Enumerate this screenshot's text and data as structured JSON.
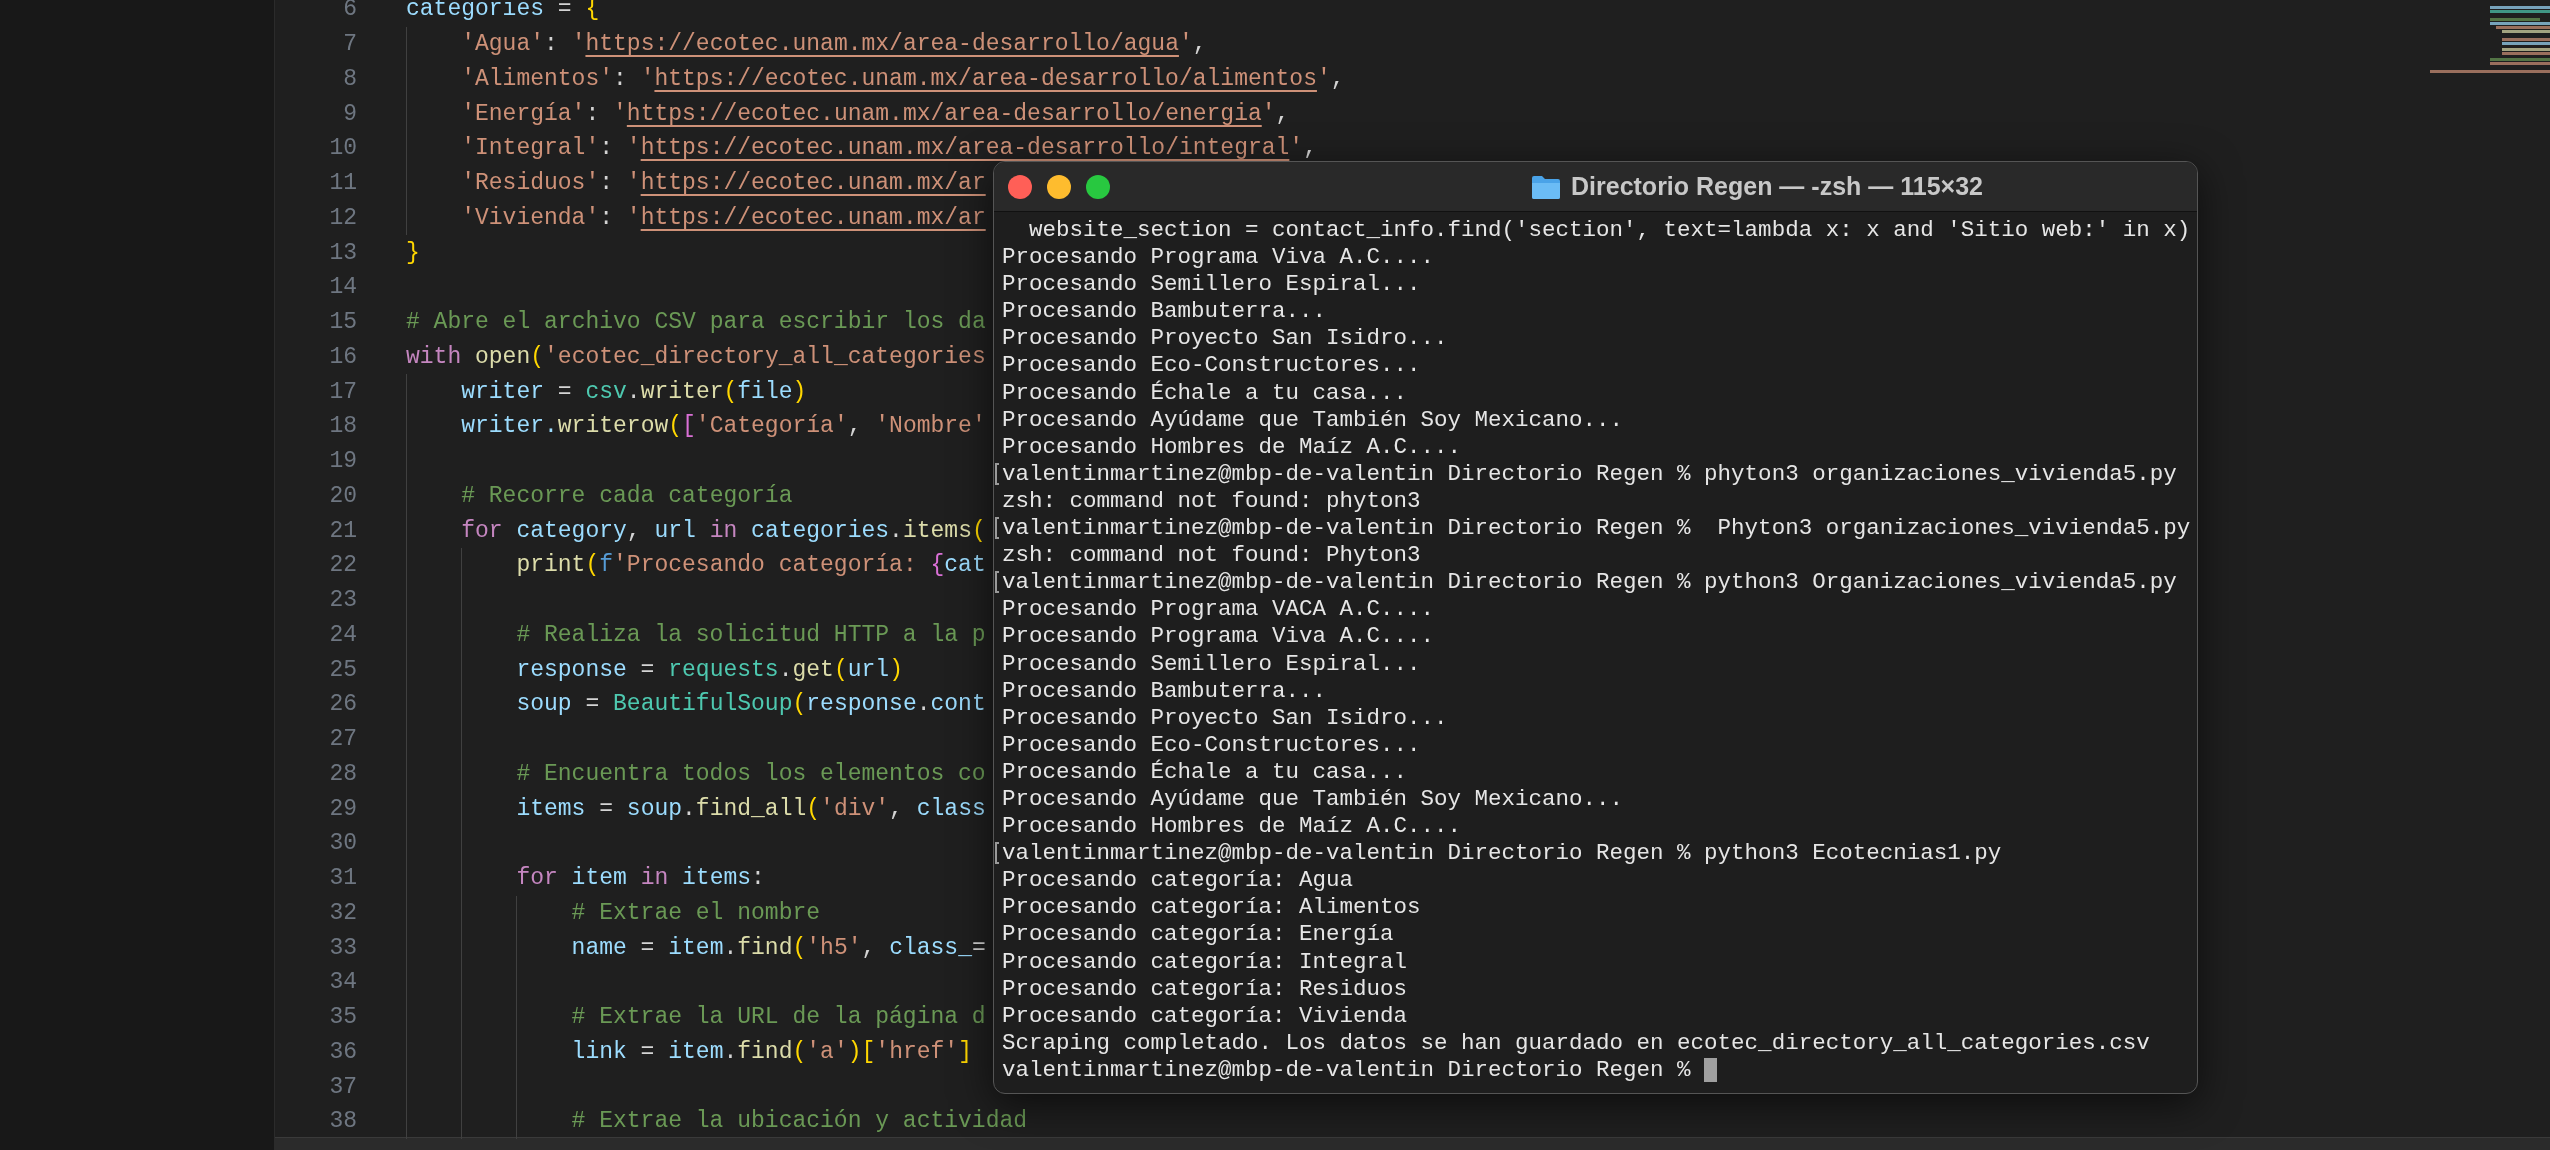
{
  "editor": {
    "lines": [
      {
        "num": "6",
        "segs": [
          {
            "text": "categories",
            "kind": "var"
          },
          {
            "text": " = ",
            "kind": "op"
          },
          {
            "text": "{",
            "kind": "br1"
          }
        ]
      },
      {
        "num": "7",
        "segs": [
          {
            "text": "    'Agua'",
            "kind": "str"
          },
          {
            "text": ": ",
            "kind": "op"
          },
          {
            "text": "'",
            "kind": "str"
          },
          {
            "text": "https://ecotec.unam.mx/area-desarrollo/agua",
            "kind": "link"
          },
          {
            "text": "'",
            "kind": "str"
          },
          {
            "text": ",",
            "kind": "op"
          }
        ]
      },
      {
        "num": "8",
        "segs": [
          {
            "text": "    'Alimentos'",
            "kind": "str"
          },
          {
            "text": ": ",
            "kind": "op"
          },
          {
            "text": "'",
            "kind": "str"
          },
          {
            "text": "https://ecotec.unam.mx/area-desarrollo/alimentos",
            "kind": "link"
          },
          {
            "text": "'",
            "kind": "str"
          },
          {
            "text": ",",
            "kind": "op"
          }
        ]
      },
      {
        "num": "9",
        "segs": [
          {
            "text": "    'Energía'",
            "kind": "str"
          },
          {
            "text": ": ",
            "kind": "op"
          },
          {
            "text": "'",
            "kind": "str"
          },
          {
            "text": "https://ecotec.unam.mx/area-desarrollo/energia",
            "kind": "link"
          },
          {
            "text": "'",
            "kind": "str"
          },
          {
            "text": ",",
            "kind": "op"
          }
        ]
      },
      {
        "num": "10",
        "segs": [
          {
            "text": "    'Integral'",
            "kind": "str"
          },
          {
            "text": ": ",
            "kind": "op"
          },
          {
            "text": "'",
            "kind": "str"
          },
          {
            "text": "https://ecotec.unam.mx/area-desarrollo/integral",
            "kind": "link"
          },
          {
            "text": "'",
            "kind": "str"
          },
          {
            "text": ",",
            "kind": "op"
          }
        ]
      },
      {
        "num": "11",
        "segs": [
          {
            "text": "    'Residuos'",
            "kind": "str"
          },
          {
            "text": ": ",
            "kind": "op"
          },
          {
            "text": "'",
            "kind": "str"
          },
          {
            "text": "https://ecotec.unam.mx/ar",
            "kind": "link"
          }
        ]
      },
      {
        "num": "12",
        "segs": [
          {
            "text": "    'Vivienda'",
            "kind": "str"
          },
          {
            "text": ": ",
            "kind": "op"
          },
          {
            "text": "'",
            "kind": "str"
          },
          {
            "text": "https://ecotec.unam.mx/ar",
            "kind": "link"
          }
        ]
      },
      {
        "num": "13",
        "segs": [
          {
            "text": "}",
            "kind": "br1"
          }
        ]
      },
      {
        "num": "14"
      },
      {
        "num": "15",
        "segs": [
          {
            "text": "# Abre el archivo CSV para escribir los da",
            "kind": "cm"
          }
        ]
      },
      {
        "num": "16",
        "segs": [
          {
            "text": "with ",
            "kind": "kw"
          },
          {
            "text": "open",
            "kind": "fn"
          },
          {
            "text": "(",
            "kind": "br1"
          },
          {
            "text": "'ecotec_directory_all_categories",
            "kind": "str"
          }
        ]
      },
      {
        "num": "17",
        "segs": [
          {
            "text": "    writer",
            "kind": "var"
          },
          {
            "text": " = ",
            "kind": "op"
          },
          {
            "text": "csv",
            "kind": "cls"
          },
          {
            "text": ".",
            "kind": "op"
          },
          {
            "text": "writer",
            "kind": "fn"
          },
          {
            "text": "(",
            "kind": "br1"
          },
          {
            "text": "file",
            "kind": "var"
          },
          {
            "text": ")",
            "kind": "br1"
          }
        ]
      },
      {
        "num": "18",
        "segs": [
          {
            "text": "    writer.",
            "kind": "var"
          },
          {
            "text": "writerow",
            "kind": "fn"
          },
          {
            "text": "(",
            "kind": "br1"
          },
          {
            "text": "[",
            "kind": "br2"
          },
          {
            "text": "'Categoría'",
            "kind": "str"
          },
          {
            "text": ", ",
            "kind": "op"
          },
          {
            "text": "'Nombre'",
            "kind": "str"
          }
        ]
      },
      {
        "num": "19"
      },
      {
        "num": "20",
        "segs": [
          {
            "text": "    # Recorre cada categoría",
            "kind": "cm"
          }
        ]
      },
      {
        "num": "21",
        "segs": [
          {
            "text": "    for ",
            "kind": "kw"
          },
          {
            "text": "category",
            "kind": "var"
          },
          {
            "text": ", ",
            "kind": "op"
          },
          {
            "text": "url ",
            "kind": "var"
          },
          {
            "text": "in ",
            "kind": "kw"
          },
          {
            "text": "categories",
            "kind": "var"
          },
          {
            "text": ".",
            "kind": "op"
          },
          {
            "text": "items",
            "kind": "fn"
          },
          {
            "text": "(",
            "kind": "br1"
          }
        ]
      },
      {
        "num": "22",
        "segs": [
          {
            "text": "        print",
            "kind": "fn"
          },
          {
            "text": "(",
            "kind": "br1"
          },
          {
            "text": "f",
            "kind": "fpre"
          },
          {
            "text": "'Procesando categoría: ",
            "kind": "str"
          },
          {
            "text": "{",
            "kind": "br2"
          },
          {
            "text": "cat",
            "kind": "var"
          }
        ]
      },
      {
        "num": "23"
      },
      {
        "num": "24",
        "segs": [
          {
            "text": "        # Realiza la solicitud HTTP a la p",
            "kind": "cm"
          }
        ]
      },
      {
        "num": "25",
        "segs": [
          {
            "text": "        response",
            "kind": "var"
          },
          {
            "text": " = ",
            "kind": "op"
          },
          {
            "text": "requests",
            "kind": "cls"
          },
          {
            "text": ".",
            "kind": "op"
          },
          {
            "text": "get",
            "kind": "fn"
          },
          {
            "text": "(",
            "kind": "br1"
          },
          {
            "text": "url",
            "kind": "var"
          },
          {
            "text": ")",
            "kind": "br1"
          }
        ]
      },
      {
        "num": "26",
        "segs": [
          {
            "text": "        soup",
            "kind": "var"
          },
          {
            "text": " = ",
            "kind": "op"
          },
          {
            "text": "BeautifulSoup",
            "kind": "cls"
          },
          {
            "text": "(",
            "kind": "br1"
          },
          {
            "text": "response",
            "kind": "var"
          },
          {
            "text": ".",
            "kind": "op"
          },
          {
            "text": "cont",
            "kind": "var"
          }
        ]
      },
      {
        "num": "27"
      },
      {
        "num": "28",
        "segs": [
          {
            "text": "        # Encuentra todos los elementos co",
            "kind": "cm"
          }
        ]
      },
      {
        "num": "29",
        "segs": [
          {
            "text": "        items",
            "kind": "var"
          },
          {
            "text": " = ",
            "kind": "op"
          },
          {
            "text": "soup",
            "kind": "var"
          },
          {
            "text": ".",
            "kind": "op"
          },
          {
            "text": "find_all",
            "kind": "fn"
          },
          {
            "text": "(",
            "kind": "br1"
          },
          {
            "text": "'div'",
            "kind": "str"
          },
          {
            "text": ", ",
            "kind": "op"
          },
          {
            "text": "class",
            "kind": "var"
          }
        ]
      },
      {
        "num": "30"
      },
      {
        "num": "31",
        "segs": [
          {
            "text": "        for ",
            "kind": "kw"
          },
          {
            "text": "item ",
            "kind": "var"
          },
          {
            "text": "in ",
            "kind": "kw"
          },
          {
            "text": "items",
            "kind": "var"
          },
          {
            "text": ":",
            "kind": "op"
          }
        ]
      },
      {
        "num": "32",
        "segs": [
          {
            "text": "            # Extrae el nombre",
            "kind": "cm"
          }
        ]
      },
      {
        "num": "33",
        "segs": [
          {
            "text": "            name",
            "kind": "var"
          },
          {
            "text": " = ",
            "kind": "op"
          },
          {
            "text": "item",
            "kind": "var"
          },
          {
            "text": ".",
            "kind": "op"
          },
          {
            "text": "find",
            "kind": "fn"
          },
          {
            "text": "(",
            "kind": "br1"
          },
          {
            "text": "'h5'",
            "kind": "str"
          },
          {
            "text": ", ",
            "kind": "op"
          },
          {
            "text": "class_",
            "kind": "var"
          },
          {
            "text": "=",
            "kind": "op"
          }
        ]
      },
      {
        "num": "34"
      },
      {
        "num": "35",
        "segs": [
          {
            "text": "            # Extrae la URL de la página d",
            "kind": "cm"
          }
        ]
      },
      {
        "num": "36",
        "segs": [
          {
            "text": "            link",
            "kind": "var"
          },
          {
            "text": " = ",
            "kind": "op"
          },
          {
            "text": "item",
            "kind": "var"
          },
          {
            "text": ".",
            "kind": "op"
          },
          {
            "text": "find",
            "kind": "fn"
          },
          {
            "text": "(",
            "kind": "br1"
          },
          {
            "text": "'a'",
            "kind": "str"
          },
          {
            "text": ")",
            "kind": "br1"
          },
          {
            "text": "[",
            "kind": "br1"
          },
          {
            "text": "'href'",
            "kind": "str"
          },
          {
            "text": "]",
            "kind": "br1"
          }
        ]
      },
      {
        "num": "37"
      },
      {
        "num": "38",
        "segs": [
          {
            "text": "            # Extrae la ubicación y actividad",
            "kind": "cm"
          }
        ]
      }
    ]
  },
  "terminal": {
    "title": "Directorio Regen — -zsh — 115×32",
    "lines": [
      {
        "text": "  website_section = contact_info.find('section', text=lambda x: x and 'Sitio web:' in x)",
        "marked": false,
        "cursor": false
      },
      {
        "text": "Procesando Programa Viva A.C....",
        "marked": false,
        "cursor": false
      },
      {
        "text": "Procesando Semillero Espiral...",
        "marked": false,
        "cursor": false
      },
      {
        "text": "Procesando Bambuterra...",
        "marked": false,
        "cursor": false
      },
      {
        "text": "Procesando Proyecto San Isidro...",
        "marked": false,
        "cursor": false
      },
      {
        "text": "Procesando Eco-Constructores...",
        "marked": false,
        "cursor": false
      },
      {
        "text": "Procesando Échale a tu casa...",
        "marked": false,
        "cursor": false
      },
      {
        "text": "Procesando Ayúdame que También Soy Mexicano...",
        "marked": false,
        "cursor": false
      },
      {
        "text": "Procesando Hombres de Maíz A.C....",
        "marked": false,
        "cursor": false
      },
      {
        "text": "valentinmartinez@mbp-de-valentin Directorio Regen % phyton3 organizaciones_vivienda5.py",
        "marked": true,
        "cursor": false
      },
      {
        "text": "zsh: command not found: phyton3",
        "marked": false,
        "cursor": false
      },
      {
        "text": "valentinmartinez@mbp-de-valentin Directorio Regen %  Phyton3 organizaciones_vivienda5.py",
        "marked": true,
        "cursor": false
      },
      {
        "text": "zsh: command not found: Phyton3",
        "marked": false,
        "cursor": false
      },
      {
        "text": "valentinmartinez@mbp-de-valentin Directorio Regen % python3 Organizaciones_vivienda5.py",
        "marked": true,
        "cursor": false
      },
      {
        "text": "Procesando Programa VACA A.C....",
        "marked": false,
        "cursor": false
      },
      {
        "text": "Procesando Programa Viva A.C....",
        "marked": false,
        "cursor": false
      },
      {
        "text": "Procesando Semillero Espiral...",
        "marked": false,
        "cursor": false
      },
      {
        "text": "Procesando Bambuterra...",
        "marked": false,
        "cursor": false
      },
      {
        "text": "Procesando Proyecto San Isidro...",
        "marked": false,
        "cursor": false
      },
      {
        "text": "Procesando Eco-Constructores...",
        "marked": false,
        "cursor": false
      },
      {
        "text": "Procesando Échale a tu casa...",
        "marked": false,
        "cursor": false
      },
      {
        "text": "Procesando Ayúdame que También Soy Mexicano...",
        "marked": false,
        "cursor": false
      },
      {
        "text": "Procesando Hombres de Maíz A.C....",
        "marked": false,
        "cursor": false
      },
      {
        "text": "valentinmartinez@mbp-de-valentin Directorio Regen % python3 Ecotecnias1.py",
        "marked": true,
        "cursor": false
      },
      {
        "text": "Procesando categoría: Agua",
        "marked": false,
        "cursor": false
      },
      {
        "text": "Procesando categoría: Alimentos",
        "marked": false,
        "cursor": false
      },
      {
        "text": "Procesando categoría: Energía",
        "marked": false,
        "cursor": false
      },
      {
        "text": "Procesando categoría: Integral",
        "marked": false,
        "cursor": false
      },
      {
        "text": "Procesando categoría: Residuos",
        "marked": false,
        "cursor": false
      },
      {
        "text": "Procesando categoría: Vivienda",
        "marked": false,
        "cursor": false
      },
      {
        "text": "Scraping completado. Los datos se han guardado en ecotec_directory_all_categories.csv",
        "marked": false,
        "cursor": false
      },
      {
        "text": "valentinmartinez@mbp-de-valentin Directorio Regen % ",
        "marked": false,
        "cursor": true
      }
    ]
  }
}
